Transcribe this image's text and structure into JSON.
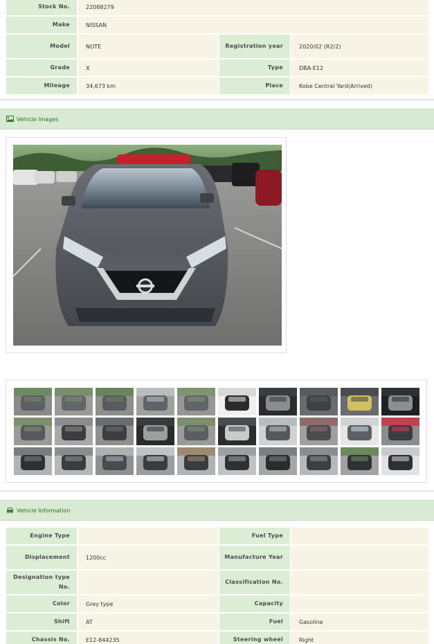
{
  "basic_info": {
    "rows": [
      {
        "label": "Stock No.",
        "value": "22088279"
      },
      {
        "label": "Make",
        "value": "NISSAN"
      },
      {
        "label": "Model",
        "value": "NOTE",
        "label2": "Registration year",
        "value2": "2020/02 (R2/2)"
      },
      {
        "label": "Grade",
        "value": "X",
        "label2": "Type",
        "value2": "DBA-E12"
      },
      {
        "label": "Mileage",
        "value": "34,673 km",
        "label2": "Place",
        "value2": "Kobe Central Yard(Arrived)"
      }
    ]
  },
  "images_section": {
    "title": "Vehicle Images",
    "icon": "image-icon"
  },
  "gallery": {
    "thumbnail_count": 30
  },
  "info_section": {
    "title": "Vehicle Information",
    "icon": "car-icon"
  },
  "vehicle_info": {
    "rows": [
      {
        "label": "Engine Type",
        "value": "",
        "label2": "Fuel Type",
        "value2": ""
      },
      {
        "label": "Displacement",
        "value": "1200cc",
        "label2": "Manufacture Year",
        "value2": ""
      },
      {
        "label": "Designation type No.",
        "value": "",
        "label2": "Classification No.",
        "value2": ""
      },
      {
        "label": "Color",
        "value": "Grey type",
        "label2": "Capacity",
        "value2": ""
      },
      {
        "label": "Shift",
        "value": "AT",
        "label2": "Fuel",
        "value2": "Gasoline"
      },
      {
        "label": "Chassis No.",
        "value": "E12-844235",
        "label2": "Steering wheel",
        "value2": "Right"
      }
    ]
  },
  "colors": {
    "label_bg": "#dcedd6",
    "value_bg": "#f7f4e6",
    "header_bg": "#d8ead3",
    "header_text": "#2f6e2a"
  }
}
